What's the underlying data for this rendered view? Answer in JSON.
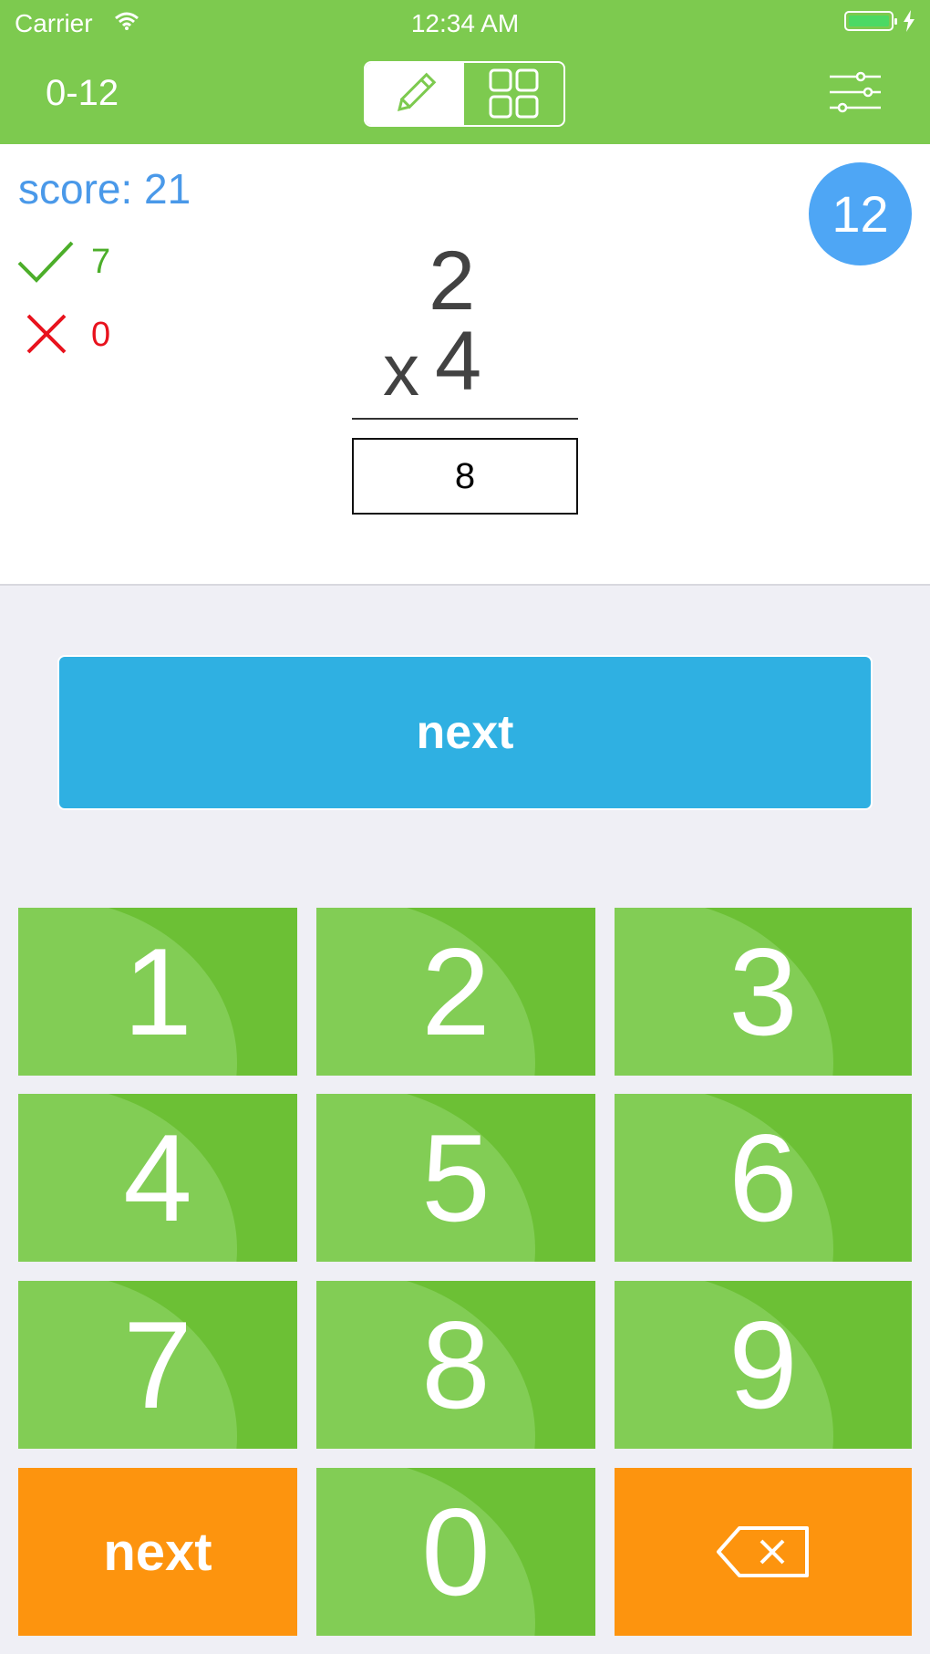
{
  "status_bar": {
    "carrier": "Carrier",
    "time": "12:34 AM"
  },
  "header": {
    "range_label": "0-12",
    "active_mode": "pencil"
  },
  "question": {
    "score_text": "score: 21",
    "correct_count": "7",
    "wrong_count": "0",
    "counter": "12",
    "operand_top": "2",
    "operator": "x",
    "operand_bottom": "4",
    "answer": "8"
  },
  "next_button": {
    "label": "next"
  },
  "keypad": {
    "keys": [
      "1",
      "2",
      "3",
      "4",
      "5",
      "6",
      "7",
      "8",
      "9",
      "0"
    ],
    "next_label": "next"
  },
  "colors": {
    "header_green": "#7dca4f",
    "key_green": "#6cc035",
    "key_orange": "#fd940e",
    "next_blue": "#2fb0e2",
    "score_blue": "#4a99e9",
    "correct_green": "#4cae2a",
    "wrong_red": "#e8121d"
  }
}
